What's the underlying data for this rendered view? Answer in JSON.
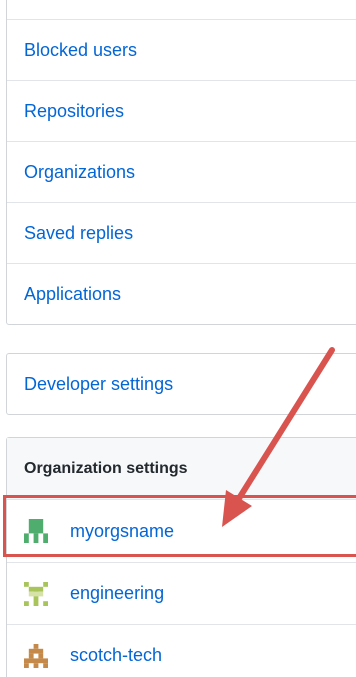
{
  "account_menu": {
    "items": [
      {
        "label": ""
      },
      {
        "label": "Blocked users"
      },
      {
        "label": "Repositories"
      },
      {
        "label": "Organizations"
      },
      {
        "label": "Saved replies"
      },
      {
        "label": "Applications"
      }
    ]
  },
  "developer_menu": {
    "label": "Developer settings"
  },
  "org_menu": {
    "heading": "Organization settings",
    "orgs": [
      {
        "name": "myorgsname",
        "avatar": "identicon-green"
      },
      {
        "name": "engineering",
        "avatar": "identicon-olive"
      },
      {
        "name": "scotch-tech",
        "avatar": "identicon-brown"
      }
    ]
  },
  "colors": {
    "link": "#0366d6",
    "highlight": "#d9534f",
    "border": "#d1d5da"
  }
}
